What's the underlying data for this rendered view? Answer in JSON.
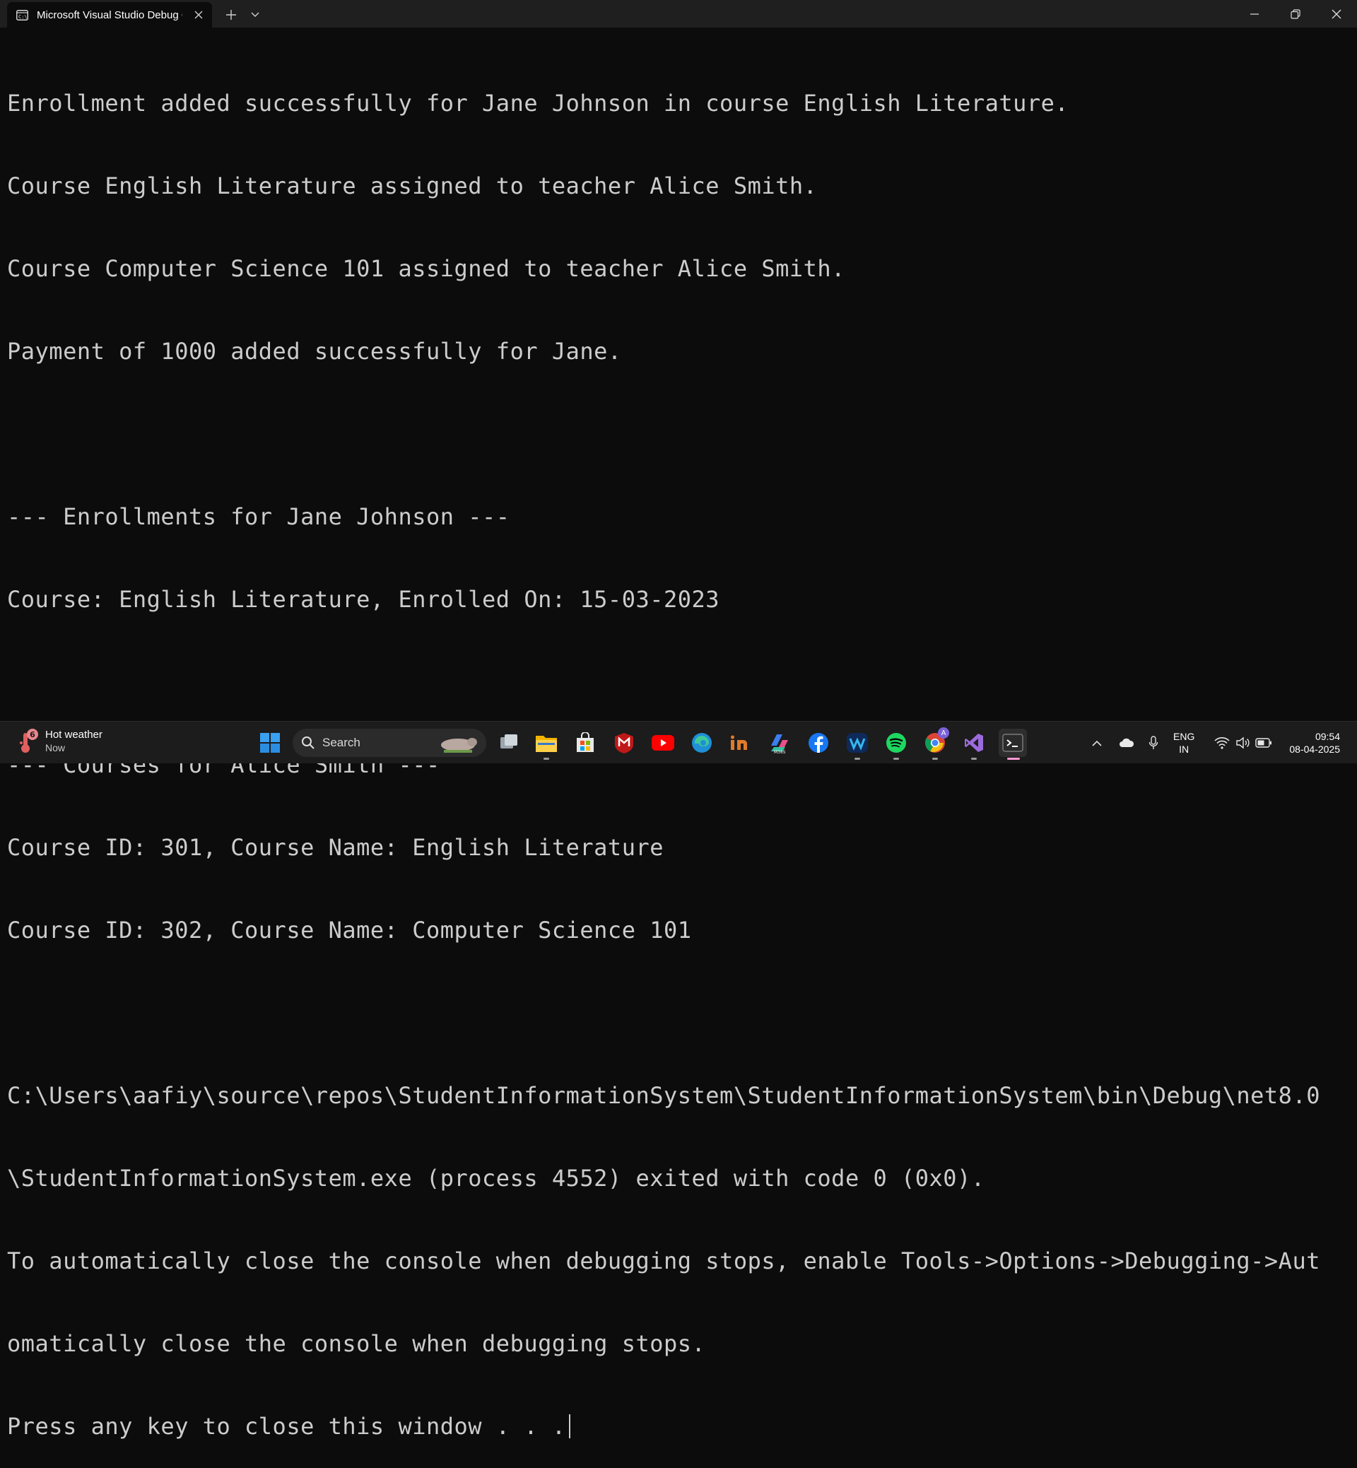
{
  "window": {
    "tab_title": "Microsoft Visual Studio Debug Console",
    "new_tab_label": "+"
  },
  "console": {
    "lines": [
      "Enrollment added successfully for Jane Johnson in course English Literature.",
      "Course English Literature assigned to teacher Alice Smith.",
      "Course Computer Science 101 assigned to teacher Alice Smith.",
      "Payment of 1000 added successfully for Jane.",
      "",
      "--- Enrollments for Jane Johnson ---",
      "Course: English Literature, Enrolled On: 15-03-2023",
      "",
      "--- Courses for Alice Smith ---",
      "Course ID: 301, Course Name: English Literature",
      "Course ID: 302, Course Name: Computer Science 101",
      "",
      "C:\\Users\\aafiy\\source\\repos\\StudentInformationSystem\\StudentInformationSystem\\bin\\Debug\\net8.0",
      "\\StudentInformationSystem.exe (process 4552) exited with code 0 (0x0).",
      "To automatically close the console when debugging stops, enable Tools->Options->Debugging->Aut",
      "omatically close the console when debugging stops.",
      "Press any key to close this window . . ."
    ]
  },
  "taskbar": {
    "weather": {
      "badge": "6",
      "title": "Hot weather",
      "subtitle": "Now"
    },
    "search_label": "Search",
    "apps": [
      "windows-start",
      "task-view",
      "file-explorer",
      "microsoft-store",
      "mcafee",
      "youtube",
      "edge",
      "instamojo",
      "copilot-m365",
      "facebook",
      "webex",
      "spotify",
      "chrome",
      "visual-studio",
      "terminal"
    ],
    "chrome_badge": "A",
    "tray": {
      "language": "ENG",
      "region": "IN",
      "time": "09:54",
      "date": "08-04-2025"
    }
  },
  "colors": {
    "console_bg": "#0c0c0c",
    "console_text": "#cccccc",
    "titlebar_bg": "#1f1f1f",
    "taskbar_bg": "#1c1c1c",
    "active_indicator": "#ff9ad5"
  }
}
